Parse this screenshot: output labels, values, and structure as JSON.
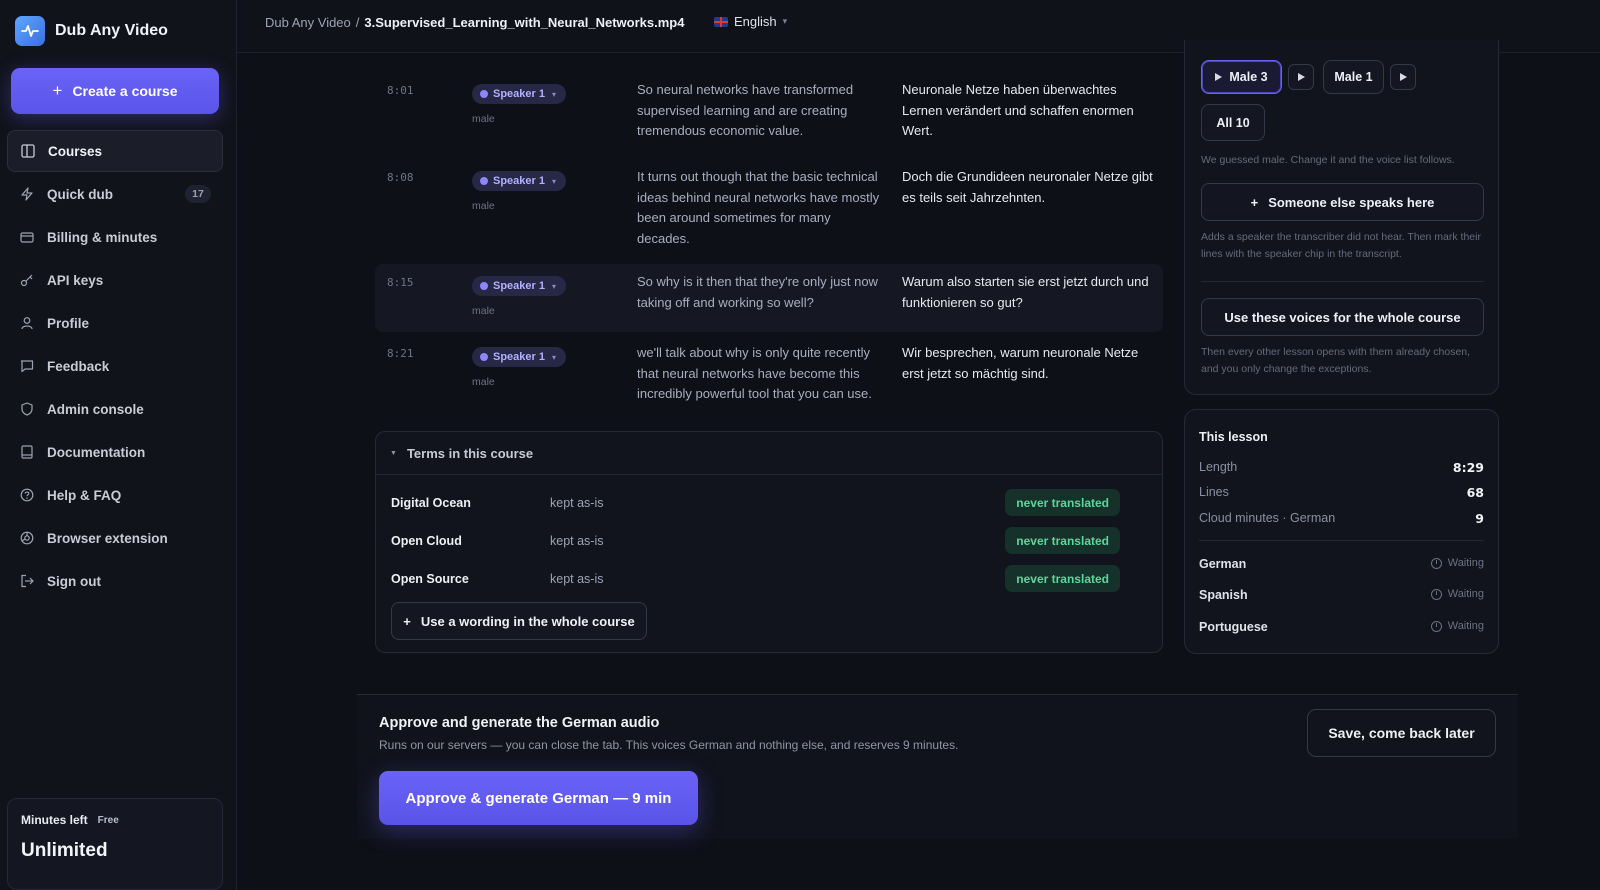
{
  "app": {
    "name": "Dub Any Video",
    "brand_color": "#4d8cf5"
  },
  "sidebar": {
    "create_label": "Create a course",
    "items": [
      {
        "label": "Courses",
        "icon": "courses-icon",
        "active": true
      },
      {
        "label": "Quick dub",
        "icon": "bolt-icon",
        "count": "17"
      },
      {
        "label": "Billing & minutes",
        "icon": "card-icon"
      },
      {
        "label": "API keys",
        "icon": "key-icon"
      },
      {
        "label": "Profile",
        "icon": "user-icon"
      },
      {
        "label": "Feedback",
        "icon": "chat-icon"
      },
      {
        "label": "Admin console",
        "icon": "shield-icon"
      },
      {
        "label": "Documentation",
        "icon": "book-icon"
      },
      {
        "label": "Help & FAQ",
        "icon": "help-icon"
      },
      {
        "label": "Browser extension",
        "icon": "extension-icon"
      },
      {
        "label": "Sign out",
        "icon": "signout-icon"
      }
    ],
    "minutes": {
      "label": "Minutes left",
      "plan": "Free",
      "value": "Unlimited"
    }
  },
  "topbar": {
    "breadcrumb_root": "Dub Any Video",
    "separator": "/",
    "breadcrumb_current": "3.Supervised_Learning_with_Neural_Networks.mp4",
    "language": "English"
  },
  "transcript": {
    "rows": [
      {
        "time": "8:01",
        "speaker": "Speaker 1",
        "gender": "male",
        "source": "So neural networks have transformed supervised learning and are creating tremendous economic value.",
        "target": "Neuronale Netze haben überwachtes Lernen verändert und schaffen enormen Wert."
      },
      {
        "time": "8:08",
        "speaker": "Speaker 1",
        "gender": "male",
        "source": "It turns out though that the basic technical ideas behind neural networks have mostly been around sometimes for many decades.",
        "target": "Doch die Grundideen neuronaler Netze gibt es teils seit Jahrzehnten."
      },
      {
        "time": "8:15",
        "speaker": "Speaker 1",
        "gender": "male",
        "source": "So why is it then that they're only just now taking off and working so well?",
        "target": "Warum also starten sie erst jetzt durch und funktionieren so gut?"
      },
      {
        "time": "8:21",
        "speaker": "Speaker 1",
        "gender": "male",
        "source": "we'll talk about why is only quite recently that neural networks have become this incredibly powerful tool that you can use.",
        "target": "Wir besprechen, warum neuronale Netze erst jetzt so mächtig sind."
      }
    ]
  },
  "terms": {
    "title": "Terms in this course",
    "items": [
      {
        "term": "Digital Ocean",
        "rule": "kept as-is",
        "tag": "never translated"
      },
      {
        "term": "Open Cloud",
        "rule": "kept as-is",
        "tag": "never translated"
      },
      {
        "term": "Open Source",
        "rule": "kept as-is",
        "tag": "never translated"
      }
    ],
    "add_label": "Use a wording in the whole course"
  },
  "voices": {
    "options": [
      {
        "label": "Male 3",
        "selected": true
      },
      {
        "label": "Male 1",
        "selected": false
      }
    ],
    "all_label": "All 10",
    "guess_hint": "We guessed male. Change it and the voice list follows.",
    "someone_else_label": "Someone else speaks here",
    "someone_else_hint": "Adds a speaker the transcriber did not hear. Then mark their lines with the speaker chip in the transcript.",
    "whole_course_label": "Use these voices for the whole course",
    "whole_course_hint": "Then every other lesson opens with them already chosen, and you only change the exceptions."
  },
  "lesson": {
    "title": "This lesson",
    "stats": [
      {
        "label": "Length",
        "value": "8:29"
      },
      {
        "label": "Lines",
        "value": "68"
      },
      {
        "label": "Cloud minutes · German",
        "value": "9"
      }
    ],
    "languages": [
      {
        "name": "German",
        "status": "Waiting"
      },
      {
        "name": "Spanish",
        "status": "Waiting"
      },
      {
        "name": "Portuguese",
        "status": "Waiting"
      }
    ]
  },
  "approve": {
    "title": "Approve and generate the German audio",
    "subtitle": "Runs on our servers — you can close the tab. This voices German and nothing else, and reserves 9 minutes.",
    "primary_label": "Approve & generate German — 9 min",
    "save_label": "Save, come back later"
  },
  "colors": {
    "accent": "#6a63f6",
    "success": "#58d99c",
    "background": "#0e1018"
  }
}
